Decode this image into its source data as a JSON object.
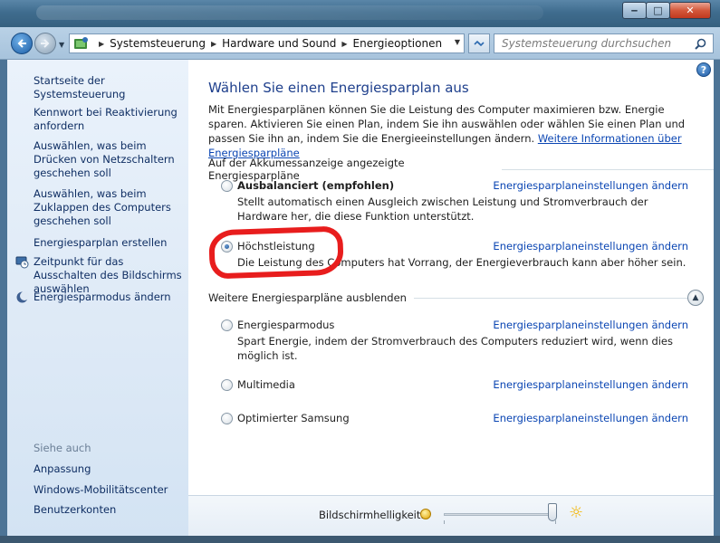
{
  "window": {
    "minimize_label": "‒",
    "maximize_label": "□",
    "close_label": "✕"
  },
  "address": {
    "crumbs": [
      "Systemsteuerung",
      "Hardware und Sound",
      "Energieoptionen"
    ],
    "search_placeholder": "Systemsteuerung durchsuchen"
  },
  "sidebar": {
    "items": [
      {
        "label": "Startseite der Systemsteuerung"
      },
      {
        "label": "Kennwort bei Reaktivierung anfordern"
      },
      {
        "label": "Auswählen, was beim Drücken von Netzschaltern geschehen soll"
      },
      {
        "label": "Auswählen, was beim Zuklappen des Computers geschehen soll"
      },
      {
        "label": "Energiesparplan erstellen"
      },
      {
        "label": "Zeitpunkt für das Ausschalten des Bildschirms auswählen",
        "icon": "monitor-clock-icon"
      },
      {
        "label": "Energiesparmodus ändern",
        "icon": "moon-icon"
      }
    ],
    "see_also_title": "Siehe auch",
    "see_also": [
      {
        "label": "Anpassung"
      },
      {
        "label": "Windows-Mobilitätscenter"
      },
      {
        "label": "Benutzerkonten"
      }
    ]
  },
  "main": {
    "help_label": "?",
    "title": "Wählen Sie einen Energiesparplan aus",
    "intro_text": "Mit Energiesparplänen können Sie die Leistung des Computer maximieren bzw. Energie sparen. Aktivieren Sie einen Plan, indem Sie ihn auswählen oder wählen Sie einen Plan und passen Sie ihn an, indem Sie die Energieeinstellungen ändern.",
    "intro_link": "Weitere Informationen über Energiesparpläne",
    "group1_title": "Auf der Akkumessanzeige angezeigte Energiesparpläne",
    "group2_title": "Weitere Energiesparpläne ausblenden",
    "change_link": "Energiesparplaneinstellungen ändern",
    "plans": [
      {
        "name": "Ausbalanciert (empfohlen)",
        "desc": "Stellt automatisch einen Ausgleich zwischen Leistung und Stromverbrauch der Hardware her, die diese Funktion unterstützt.",
        "selected": false
      },
      {
        "name": "Höchstleistung",
        "desc": "Die Leistung des Computers hat Vorrang, der Energieverbrauch kann aber höher sein.",
        "selected": true
      },
      {
        "name": "Energiesparmodus",
        "desc": "Spart Energie, indem der Stromverbrauch des Computers reduziert wird, wenn dies möglich ist.",
        "selected": false
      },
      {
        "name": "Multimedia",
        "desc": "",
        "selected": false
      },
      {
        "name": "Optimierter Samsung",
        "desc": "",
        "selected": false
      }
    ],
    "brightness_label": "Bildschirmhelligkeit:",
    "brightness_level": 0.97
  },
  "colors": {
    "link": "#0b46b3",
    "title": "#1e3f8c",
    "annotation": "#e81d1d"
  }
}
